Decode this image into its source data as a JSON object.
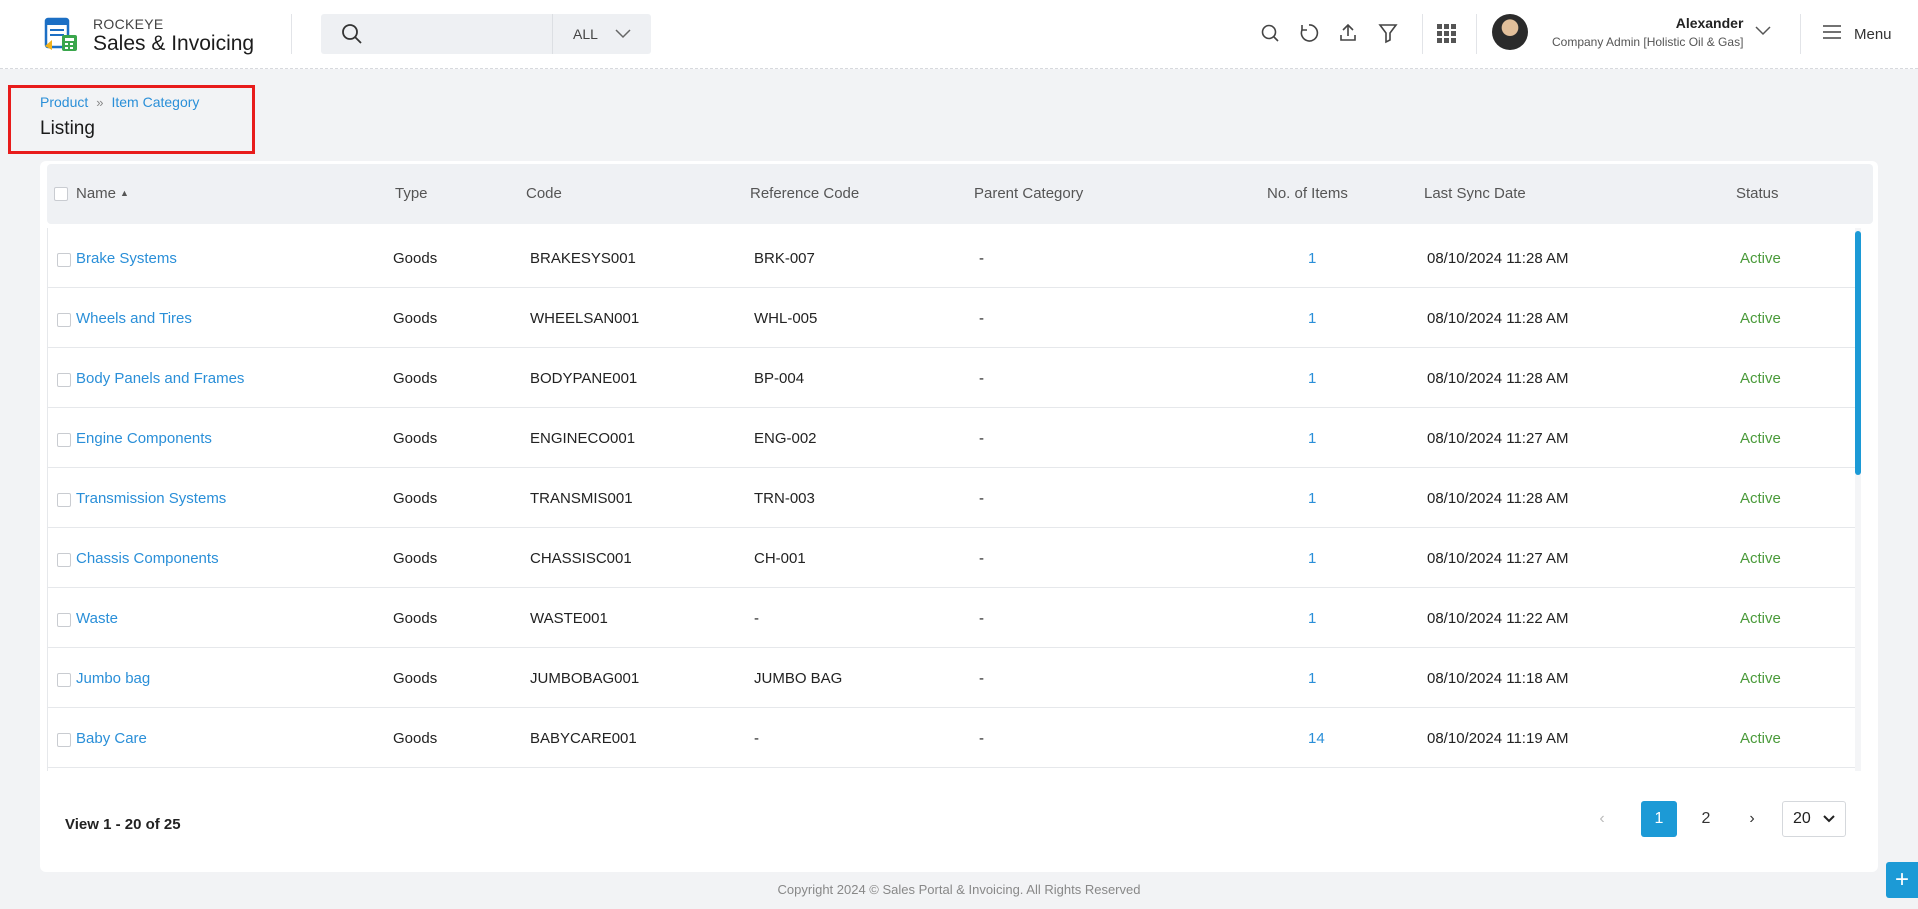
{
  "header": {
    "brand_small": "ROCKEYE",
    "brand_big": "Sales & Invoicing",
    "search_placeholder": "",
    "search_scope": "ALL",
    "user_name": "Alexander",
    "user_role": "Company Admin [Holistic Oil & Gas]",
    "menu_label": "Menu"
  },
  "breadcrumb": {
    "items": [
      "Product",
      "Item Category"
    ],
    "title": "Listing"
  },
  "table": {
    "columns": [
      "Name",
      "Type",
      "Code",
      "Reference Code",
      "Parent Category",
      "No. of Items",
      "Last Sync Date",
      "Status"
    ],
    "rows": [
      {
        "name": "Brake Systems",
        "type": "Goods",
        "code": "BRAKESYS001",
        "ref": "BRK-007",
        "parent": "-",
        "count": "1",
        "sync": "08/10/2024 11:28 AM",
        "status": "Active"
      },
      {
        "name": "Wheels and Tires",
        "type": "Goods",
        "code": "WHEELSAN001",
        "ref": "WHL-005",
        "parent": "-",
        "count": "1",
        "sync": "08/10/2024 11:28 AM",
        "status": "Active"
      },
      {
        "name": "Body Panels and Frames",
        "type": "Goods",
        "code": "BODYPANE001",
        "ref": "BP-004",
        "parent": "-",
        "count": "1",
        "sync": "08/10/2024 11:28 AM",
        "status": "Active"
      },
      {
        "name": "Engine Components",
        "type": "Goods",
        "code": "ENGINECO001",
        "ref": "ENG-002",
        "parent": "-",
        "count": "1",
        "sync": "08/10/2024 11:27 AM",
        "status": "Active"
      },
      {
        "name": "Transmission Systems",
        "type": "Goods",
        "code": "TRANSMIS001",
        "ref": "TRN-003",
        "parent": "-",
        "count": "1",
        "sync": "08/10/2024 11:28 AM",
        "status": "Active"
      },
      {
        "name": "Chassis Components",
        "type": "Goods",
        "code": "CHASSISC001",
        "ref": "CH-001",
        "parent": "-",
        "count": "1",
        "sync": "08/10/2024 11:27 AM",
        "status": "Active"
      },
      {
        "name": "Waste",
        "type": "Goods",
        "code": "WASTE001",
        "ref": "-",
        "parent": "-",
        "count": "1",
        "sync": "08/10/2024 11:22 AM",
        "status": "Active"
      },
      {
        "name": "Jumbo bag",
        "type": "Goods",
        "code": "JUMBOBAG001",
        "ref": "JUMBO BAG",
        "parent": "-",
        "count": "1",
        "sync": "08/10/2024 11:18 AM",
        "status": "Active"
      },
      {
        "name": "Baby Care",
        "type": "Goods",
        "code": "BABYCARE001",
        "ref": "-",
        "parent": "-",
        "count": "14",
        "sync": "08/10/2024 11:19 AM",
        "status": "Active"
      }
    ]
  },
  "pagination": {
    "view_text": "View 1 - 20 of 25",
    "pages": [
      "1",
      "2"
    ],
    "current_page": "1",
    "page_size": "20"
  },
  "footer": {
    "text": "Copyright 2024 © Sales Portal & Invoicing. All Rights Reserved"
  },
  "colors": {
    "accent": "#1c9ad6",
    "link": "#2a8fd8",
    "status_active": "#4a9a3a",
    "highlight_box": "#e81b1b"
  }
}
